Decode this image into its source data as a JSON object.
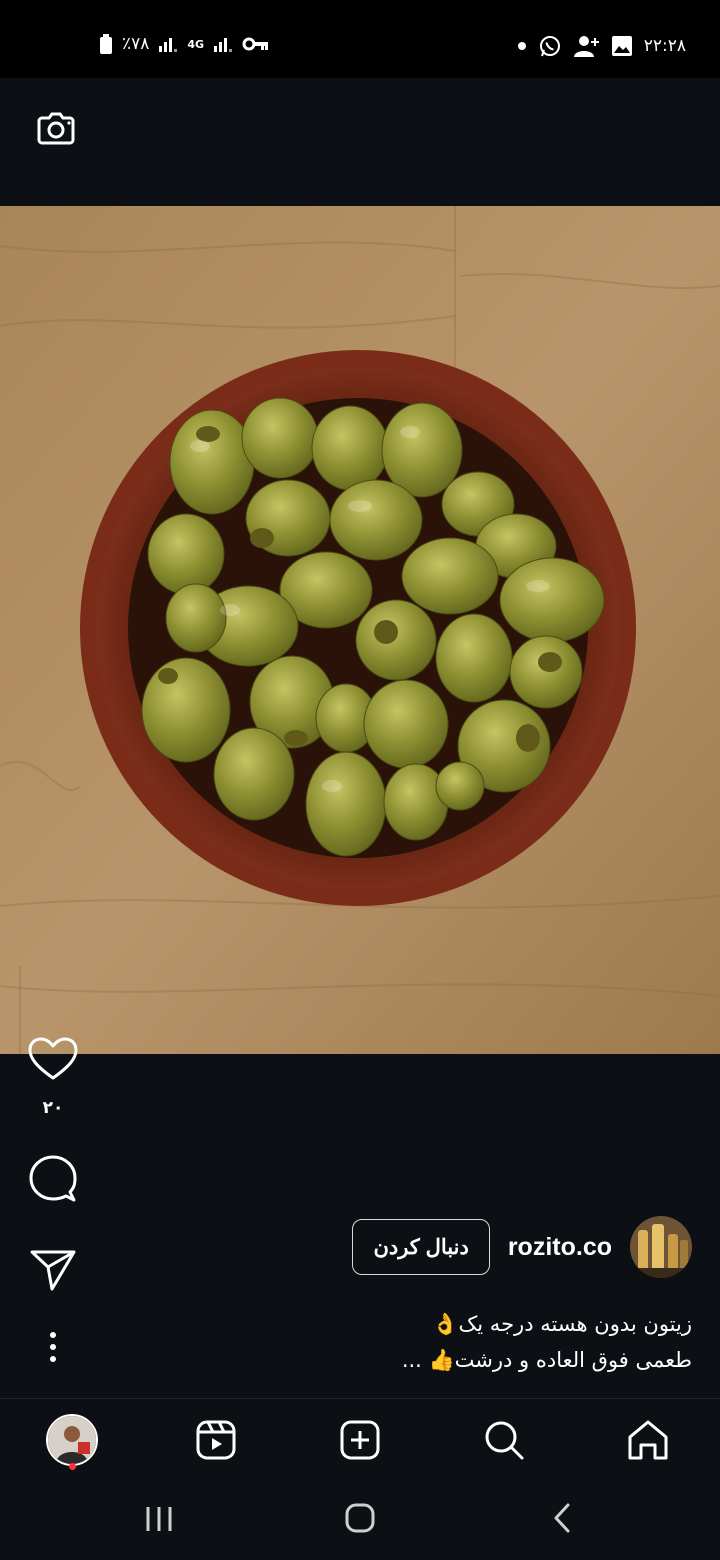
{
  "status_bar": {
    "time": "۲۲:۲۸",
    "battery": "٪۷۸",
    "network": "4G",
    "icons_left": [
      "battery-icon",
      "signal-icon",
      "network-4g-icon",
      "signal-icon",
      "vpn-key-icon"
    ],
    "icons_right": [
      "notification-dot-icon",
      "whatsapp-icon",
      "add-user-icon",
      "gallery-icon"
    ]
  },
  "top_bar": {
    "camera_icon": "camera-icon"
  },
  "post": {
    "image": "olives-in-bowl",
    "like_count": "۲۰",
    "author": {
      "username": "rozito.co",
      "follow_label": "دنبال کردن"
    },
    "caption": {
      "line1": "زیتون بدون هسته درجه یک👌",
      "line2": "طعمی فوق العاده و درشت👍 ..."
    }
  },
  "actions": [
    "like-icon",
    "comment-icon",
    "share-icon",
    "more-icon"
  ],
  "bottom_nav": [
    "profile",
    "reels",
    "create",
    "search",
    "home"
  ],
  "system_nav": [
    "recent-apps",
    "home",
    "back"
  ],
  "colors": {
    "background": "#0c0f14",
    "status_bar": "#000000",
    "notification_dot": "#ff3040"
  }
}
